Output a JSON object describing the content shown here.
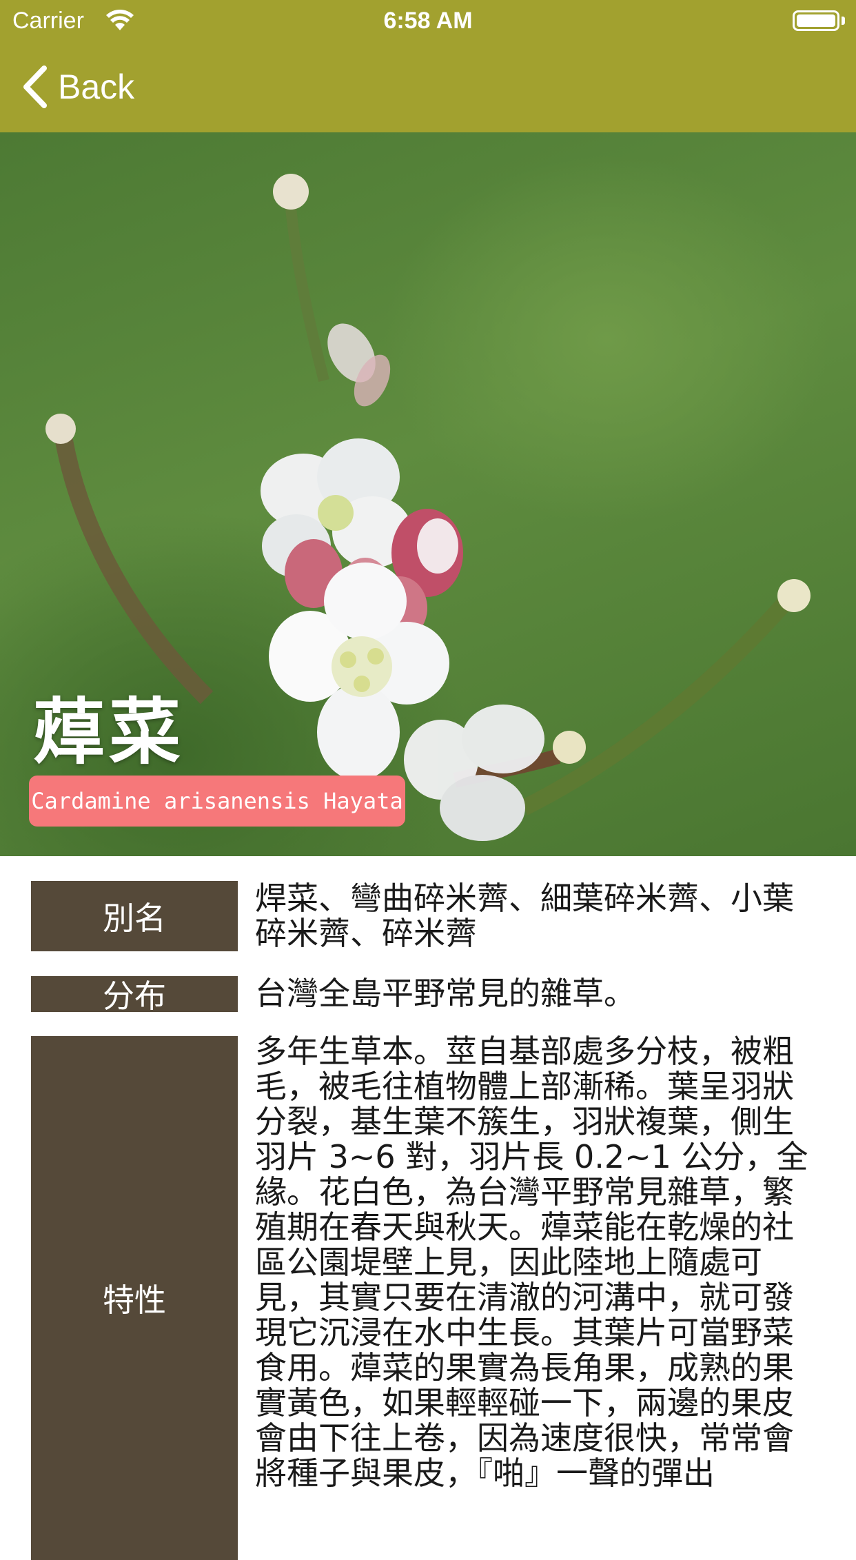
{
  "status_bar": {
    "carrier": "Carrier",
    "time": "6:58 AM"
  },
  "nav": {
    "back_label": "Back",
    "color": "#a2a12f"
  },
  "plant": {
    "name": "蔊菜",
    "scientific_name": "Cardamine arisanensis Hayata",
    "badge_color": "#f6787a"
  },
  "details": [
    {
      "label": "別名",
      "value": "焊菜、彎曲碎米薺、細葉碎米薺、小葉碎米薺、碎米薺"
    },
    {
      "label": "分布",
      "value": "台灣全島平野常見的雜草。"
    },
    {
      "label": "特性",
      "value": "多年生草本。莖自基部處多分枝，被粗毛，被毛往植物體上部漸稀。葉呈羽狀分裂，基生葉不簇生，羽狀複葉，側生羽片 3~6 對，羽片長 0.2~1 公分，全緣。花白色，為台灣平野常見雜草，繁殖期在春天與秋天。蔊菜能在乾燥的社區公園堤壁上見，因此陸地上隨處可見，其實只要在清澈的河溝中，就可發現它沉浸在水中生長。其葉片可當野菜食用。蔊菜的果實為長角果，成熟的果實黃色，如果輕輕碰一下，兩邊的果皮會由下往上卷，因為速度很快，常常會將種子與果皮，『啪』一聲的彈出"
    }
  ],
  "label_color": "#554939"
}
